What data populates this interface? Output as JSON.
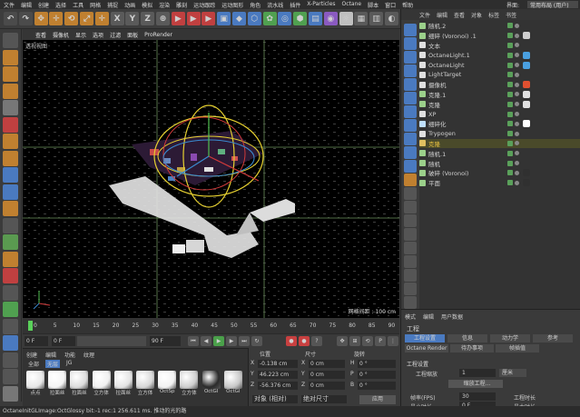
{
  "menubar": {
    "items": [
      "文件",
      "编辑",
      "创建",
      "选择",
      "工具",
      "网格",
      "捕捉",
      "动画",
      "模拟",
      "渲染",
      "雕刻",
      "运动跟踪",
      "运动图形",
      "角色",
      "流水线",
      "插件",
      "X-Particles",
      "Octane",
      "脚本",
      "窗口",
      "帮助"
    ],
    "interface_label": "界面:",
    "layout_value": "常用布局 (用户)"
  },
  "toolbar": {
    "icons": [
      "↶",
      "↷",
      "✥",
      "✛",
      "⟲",
      "⤢",
      "✛",
      "X",
      "Y",
      "Z",
      "⊕",
      "▶",
      "▶",
      "▶",
      "▣",
      "◆",
      "⬡",
      "✿",
      "◎",
      "⬢",
      "▤",
      "◉",
      "☼",
      "▦",
      "▥",
      "◐",
      "▬"
    ]
  },
  "viewport": {
    "menu": [
      "查看",
      "摄像机",
      "显示",
      "选项",
      "过滤",
      "面板",
      "ProRender"
    ],
    "label": "透视视图",
    "grid_label": "网格间距 : 100 cm"
  },
  "timeline": {
    "ticks": [
      "0",
      "5",
      "10",
      "15",
      "20",
      "25",
      "30",
      "35",
      "40",
      "45",
      "50",
      "55",
      "60",
      "65",
      "70",
      "75",
      "80",
      "85",
      "90"
    ],
    "current_frame": "0 F",
    "start": "0 F",
    "end_left": "90 F",
    "end_right": "90 F",
    "frame_label": "0 F"
  },
  "materials": {
    "tabs": [
      "创建",
      "编辑",
      "功能",
      "纹理"
    ],
    "filters": [
      "全部",
      "无层",
      "JG"
    ],
    "items": [
      {
        "label": "点点",
        "color": "#e8e8e8"
      },
      {
        "label": "拉面丝",
        "color": "#f4f4f4"
      },
      {
        "label": "拉面丝",
        "color": "#dcdcdc"
      },
      {
        "label": "立方体",
        "color": "#f0f0f0"
      },
      {
        "label": "拉面丝",
        "color": "#e4e4e4"
      },
      {
        "label": "立方体",
        "color": "#d8d8d8"
      },
      {
        "label": "OctSp",
        "color": "#f2f2f2"
      },
      {
        "label": "立方体",
        "color": "#cfcfcf"
      },
      {
        "label": "OctGl",
        "color": "#2a2a2a"
      },
      {
        "label": "OctGl",
        "color": "#c8c8c8"
      }
    ]
  },
  "coords": {
    "headers": [
      "位置",
      "尺寸",
      "旋转"
    ],
    "rows": [
      {
        "axis": "X",
        "pos": "-0.138 cm",
        "size": "0 cm",
        "rot_axis": "H",
        "rot": "0 °"
      },
      {
        "axis": "Y",
        "pos": "46.223 cm",
        "size": "0 cm",
        "rot_axis": "P",
        "rot": "0 °"
      },
      {
        "axis": "Z",
        "pos": "-56.376 cm",
        "size": "0 cm",
        "rot_axis": "B",
        "rot": "0 °"
      }
    ],
    "mode_select": "对象 (相对)",
    "size_select": "绝对尺寸",
    "apply": "应用"
  },
  "objmgr": {
    "menu": [
      "文件",
      "编辑",
      "查看",
      "对象",
      "标签",
      "书签"
    ],
    "objects": [
      {
        "name": "随机.2",
        "color": "#9bd08a",
        "tag": ""
      },
      {
        "name": "细碎 (Voronoi) .1",
        "color": "#9bd08a",
        "tag": "#cfcfcf"
      },
      {
        "name": "文本",
        "color": "#e0e0e0",
        "tag": ""
      },
      {
        "name": "OctaneLight.1",
        "color": "#e0e0e0",
        "tag": "#4aa0e0"
      },
      {
        "name": "OctaneLight",
        "color": "#e0e0e0",
        "tag": "#4aa0e0"
      },
      {
        "name": "LightTarget",
        "color": "#e0e0e0",
        "tag": ""
      },
      {
        "name": "摄像机",
        "color": "#e0e0e0",
        "tag": "#e05030"
      },
      {
        "name": "克隆.1",
        "color": "#9bd08a",
        "tag": "#e0e0e0"
      },
      {
        "name": "克隆",
        "color": "#9bd08a",
        "tag": "#e0e0e0"
      },
      {
        "name": "XP",
        "color": "#e0e0e0",
        "tag": ""
      },
      {
        "name": "细碎化",
        "color": "#c0e0ff",
        "tag": "#ffffff"
      },
      {
        "name": "Trypogen",
        "color": "#e0e0e0",
        "tag": ""
      },
      {
        "name": "克隆",
        "color": "#e0c060",
        "tag": ""
      },
      {
        "name": "随机.1",
        "color": "#9bd08a",
        "tag": ""
      },
      {
        "name": "随机",
        "color": "#9bd08a",
        "tag": ""
      },
      {
        "name": "破碎 (Voronoi)",
        "color": "#9bd08a",
        "tag": "#303030"
      },
      {
        "name": "平面",
        "color": "#9bd08a",
        "tag": "#303030"
      }
    ]
  },
  "attrmgr": {
    "menu": [
      "模式",
      "编辑",
      "用户数据"
    ],
    "title": "工程",
    "tabs_row1": [
      "工程设置",
      "信息",
      "动力学",
      "参考"
    ],
    "tabs_row2": [
      "Octane Render",
      "待办事项",
      "帧插值"
    ],
    "section": "工程设置",
    "scale_label": "工程缩放",
    "scale_value": "1",
    "scale_unit": "厘米",
    "scale_button": "缩放工程...",
    "fps_label": "帧率(FPS)",
    "fps_value": "30",
    "time_label": "工程时长",
    "min_label": "最小时长",
    "min_value": "0 F",
    "max_label": "最大时长"
  },
  "status": {
    "text": "OctaneInitGLImage:OctGlossy  bit:-1 rec:1  256.611 ms.   推动的光的路"
  }
}
